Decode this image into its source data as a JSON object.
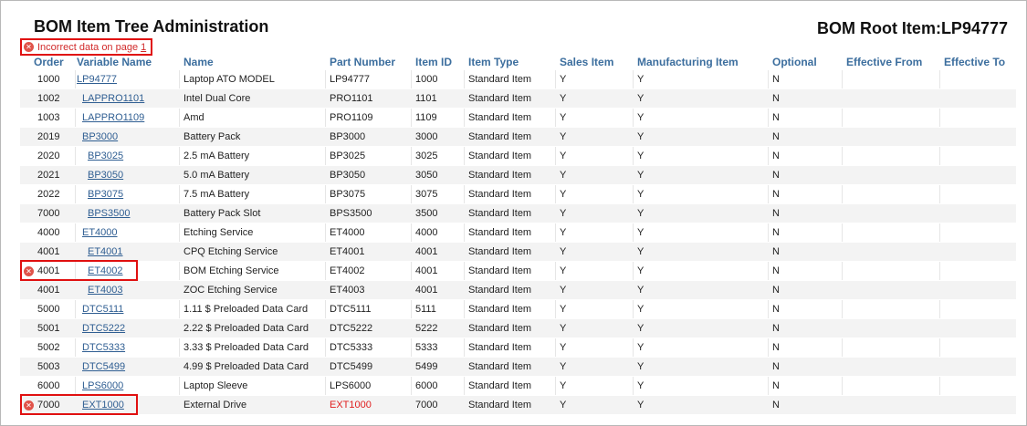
{
  "page": {
    "title": "BOM Item Tree Administration",
    "root_label": "BOM Root Item:",
    "root_value": "LP94777"
  },
  "error_banner": {
    "text": "Incorrect data on page",
    "link": "1"
  },
  "columns": {
    "order": "Order",
    "variable_name": "Variable Name",
    "name": "Name",
    "part_number": "Part Number",
    "item_id": "Item ID",
    "item_type": "Item Type",
    "sales_item": "Sales Item",
    "manufacturing_item": "Manufacturing Item",
    "optional": "Optional",
    "effective_from": "Effective From",
    "effective_to": "Effective To"
  },
  "rows": [
    {
      "order": "1000",
      "var": "LP94777",
      "indent": 0,
      "name": "Laptop ATO MODEL",
      "part": "LP94777",
      "id": "1000",
      "type": "Standard Item",
      "sales": "Y",
      "mfg": "Y",
      "opt": "N",
      "error": false,
      "part_error": false
    },
    {
      "order": "1002",
      "var": "LAPPRO1101",
      "indent": 1,
      "name": "Intel Dual Core",
      "part": "PRO1101",
      "id": "1101",
      "type": "Standard Item",
      "sales": "Y",
      "mfg": "Y",
      "opt": "N",
      "error": false,
      "part_error": false
    },
    {
      "order": "1003",
      "var": "LAPPRO1109",
      "indent": 1,
      "name": "Amd",
      "part": "PRO1109",
      "id": "1109",
      "type": "Standard Item",
      "sales": "Y",
      "mfg": "Y",
      "opt": "N",
      "error": false,
      "part_error": false
    },
    {
      "order": "2019",
      "var": "BP3000",
      "indent": 1,
      "name": "Battery Pack",
      "part": "BP3000",
      "id": "3000",
      "type": "Standard Item",
      "sales": "Y",
      "mfg": "Y",
      "opt": "N",
      "error": false,
      "part_error": false
    },
    {
      "order": "2020",
      "var": "BP3025",
      "indent": 2,
      "name": "2.5 mA Battery",
      "part": "BP3025",
      "id": "3025",
      "type": "Standard Item",
      "sales": "Y",
      "mfg": "Y",
      "opt": "N",
      "error": false,
      "part_error": false
    },
    {
      "order": "2021",
      "var": "BP3050",
      "indent": 2,
      "name": "5.0 mA Battery",
      "part": "BP3050",
      "id": "3050",
      "type": "Standard Item",
      "sales": "Y",
      "mfg": "Y",
      "opt": "N",
      "error": false,
      "part_error": false
    },
    {
      "order": "2022",
      "var": "BP3075",
      "indent": 2,
      "name": "7.5 mA Battery",
      "part": "BP3075",
      "id": "3075",
      "type": "Standard Item",
      "sales": "Y",
      "mfg": "Y",
      "opt": "N",
      "error": false,
      "part_error": false
    },
    {
      "order": "7000",
      "var": "BPS3500",
      "indent": 2,
      "name": "Battery Pack Slot",
      "part": "BPS3500",
      "id": "3500",
      "type": "Standard Item",
      "sales": "Y",
      "mfg": "Y",
      "opt": "N",
      "error": false,
      "part_error": false
    },
    {
      "order": "4000",
      "var": "ET4000",
      "indent": 1,
      "name": "Etching Service",
      "part": "ET4000",
      "id": "4000",
      "type": "Standard Item",
      "sales": "Y",
      "mfg": "Y",
      "opt": "N",
      "error": false,
      "part_error": false
    },
    {
      "order": "4001",
      "var": "ET4001",
      "indent": 2,
      "name": "CPQ Etching Service",
      "part": "ET4001",
      "id": "4001",
      "type": "Standard Item",
      "sales": "Y",
      "mfg": "Y",
      "opt": "N",
      "error": false,
      "part_error": false
    },
    {
      "order": "4001",
      "var": "ET4002",
      "indent": 2,
      "name": "BOM Etching Service",
      "part": "ET4002",
      "id": "4001",
      "type": "Standard Item",
      "sales": "Y",
      "mfg": "Y",
      "opt": "N",
      "error": true,
      "part_error": false
    },
    {
      "order": "4001",
      "var": "ET4003",
      "indent": 2,
      "name": "ZOC Etching Service",
      "part": "ET4003",
      "id": "4001",
      "type": "Standard Item",
      "sales": "Y",
      "mfg": "Y",
      "opt": "N",
      "error": false,
      "part_error": false
    },
    {
      "order": "5000",
      "var": "DTC5111",
      "indent": 1,
      "name": "1.11 $ Preloaded Data Card",
      "part": "DTC5111",
      "id": "5111",
      "type": "Standard Item",
      "sales": "Y",
      "mfg": "Y",
      "opt": "N",
      "error": false,
      "part_error": false
    },
    {
      "order": "5001",
      "var": "DTC5222",
      "indent": 1,
      "name": "2.22 $ Preloaded Data Card",
      "part": "DTC5222",
      "id": "5222",
      "type": "Standard Item",
      "sales": "Y",
      "mfg": "Y",
      "opt": "N",
      "error": false,
      "part_error": false
    },
    {
      "order": "5002",
      "var": "DTC5333",
      "indent": 1,
      "name": "3.33 $ Preloaded Data Card",
      "part": "DTC5333",
      "id": "5333",
      "type": "Standard Item",
      "sales": "Y",
      "mfg": "Y",
      "opt": "N",
      "error": false,
      "part_error": false
    },
    {
      "order": "5003",
      "var": "DTC5499",
      "indent": 1,
      "name": "4.99 $ Preloaded Data Card",
      "part": "DTC5499",
      "id": "5499",
      "type": "Standard Item",
      "sales": "Y",
      "mfg": "Y",
      "opt": "N",
      "error": false,
      "part_error": false
    },
    {
      "order": "6000",
      "var": "LPS6000",
      "indent": 1,
      "name": "Laptop Sleeve",
      "part": "LPS6000",
      "id": "6000",
      "type": "Standard Item",
      "sales": "Y",
      "mfg": "Y",
      "opt": "N",
      "error": false,
      "part_error": false
    },
    {
      "order": "7000",
      "var": "EXT1000",
      "indent": 1,
      "name": "External Drive",
      "part": "EXT1000",
      "id": "7000",
      "type": "Standard Item",
      "sales": "Y",
      "mfg": "Y",
      "opt": "N",
      "error": true,
      "part_error": true
    }
  ],
  "colors": {
    "link": "#2f5e92",
    "header": "#3c6e9e",
    "error": "#e01010"
  },
  "icons": {
    "error": "error-circle-icon"
  }
}
